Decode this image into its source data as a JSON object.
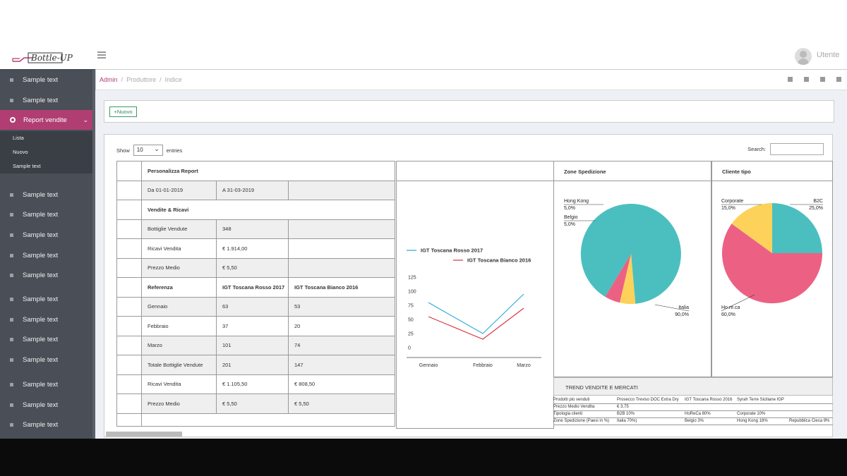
{
  "header": {
    "logo_text": "Bottle-UP",
    "user_label": "Utente"
  },
  "breadcrumb": {
    "items": [
      "Admin",
      "Produttore",
      "Indice"
    ]
  },
  "sidebar": {
    "items": [
      {
        "label": "Sample text"
      },
      {
        "label": "Sample text"
      },
      {
        "label": "Report vendite",
        "active": true
      },
      {
        "label": "Sample text"
      },
      {
        "label": "Sample text"
      },
      {
        "label": "Sample text"
      },
      {
        "label": "Sample text"
      },
      {
        "label": "Sample text"
      },
      {
        "label": "Sample text"
      },
      {
        "label": "Sample text"
      },
      {
        "label": "Sample text"
      },
      {
        "label": "Sample text"
      },
      {
        "label": "Sample text"
      },
      {
        "label": "Sample text"
      },
      {
        "label": "Sample text"
      }
    ],
    "submenu": [
      "Lista",
      "Nuovo",
      "Sample text"
    ]
  },
  "toolbar": {
    "new_label": "Nuovo"
  },
  "table_controls": {
    "show": "Show",
    "entries_value": "10",
    "entries": "entries",
    "search": "Search:"
  },
  "report": {
    "title": "Personalizza Report",
    "date_from": "Da 01-01-2019",
    "date_to": "A 31-03-2019",
    "section1": "Vendite & Ricavi",
    "rows1": [
      {
        "label": "Bottiglie Vendute",
        "value": "348"
      },
      {
        "label": "Ricavi Vendita",
        "value": "€ 1.914,00"
      },
      {
        "label": "Prezzo Medio",
        "value": "€ 5,50"
      }
    ],
    "ref_header": [
      "Referenza",
      "IGT Toscana Rosso 2017",
      "IGT Toscana Bianco 2016"
    ],
    "rows2": [
      {
        "label": "Gennaio",
        "a": "63",
        "b": "53"
      },
      {
        "label": "Febbraio",
        "a": "37",
        "b": "20"
      },
      {
        "label": "Marzo",
        "a": "101",
        "b": "74"
      },
      {
        "label": "Totale Bottiglie Vendute",
        "a": "201",
        "b": "147"
      },
      {
        "label": "Ricavi Vendita",
        "a": "€ 1.105,50",
        "b": "€ 808,50"
      },
      {
        "label": "Prezzo Medio",
        "a": "€ 5,50",
        "b": "€ 5,50"
      }
    ]
  },
  "zone": {
    "title": "Zone Spedizione"
  },
  "cliente": {
    "title": "Cliente tipo"
  },
  "trend": {
    "title": "TREND VENDITE E MERCATI",
    "rows": [
      [
        "Prodotti più venduti",
        "Prosecco Treviso DOC Extra Dry",
        "IGT Toscana Rosso 2016",
        "Syrah Terre Siciliane IGP",
        ""
      ],
      [
        "Prezzo Medio Vendita",
        "€ 3,75",
        "",
        "",
        ""
      ],
      [
        "Tipologia clienti",
        "B2B 10%",
        "HoReCa 80%",
        "Corporate 10%",
        ""
      ],
      [
        "Zone Spedizione (Paesi in %)",
        "Italia 70%)",
        "Belgio 3%",
        "Hong Kong 18%",
        "Repubblica Cieca 9%"
      ]
    ]
  },
  "colors": {
    "accent": "#b03e72",
    "blue": "#29a7d6",
    "red": "#d9303c",
    "teal": "#4bbfbf",
    "pink": "#ec6183",
    "yellow": "#fcd25a"
  },
  "chart_data": [
    {
      "type": "line",
      "categories": [
        "Gennaio",
        "Febbraio",
        "Marzo"
      ],
      "ylim": [
        0,
        125
      ],
      "yticks": [
        "125",
        "100",
        "75",
        "50",
        "25",
        "0"
      ],
      "series": [
        {
          "name": "IGT Toscana Rosso 2017",
          "values": [
            80,
            25,
            95
          ],
          "color": "#29a7d6"
        },
        {
          "name": "IGT Toscana Bianco 2016",
          "values": [
            55,
            15,
            70
          ],
          "color": "#d9303c"
        }
      ]
    },
    {
      "type": "pie",
      "title": "Zone Spedizione",
      "slices": [
        {
          "label": "Italia",
          "value": 90.0,
          "display": "90,0%",
          "color": "#4bbfbf"
        },
        {
          "label": "Hong Kong",
          "value": 5.0,
          "display": "5,0%",
          "color": "#fcd25a"
        },
        {
          "label": "Belgio",
          "value": 5.0,
          "display": "5,0%",
          "color": "#ec6183"
        }
      ]
    },
    {
      "type": "pie",
      "title": "Cliente tipo",
      "slices": [
        {
          "label": "B2C",
          "value": 25.0,
          "display": "25,0%",
          "color": "#4bbfbf"
        },
        {
          "label": "Ho.re.ca",
          "value": 60.0,
          "display": "60,0%",
          "color": "#ec6183"
        },
        {
          "label": "Corporate",
          "value": 15.0,
          "display": "15,0%",
          "color": "#fcd25a"
        }
      ]
    }
  ]
}
